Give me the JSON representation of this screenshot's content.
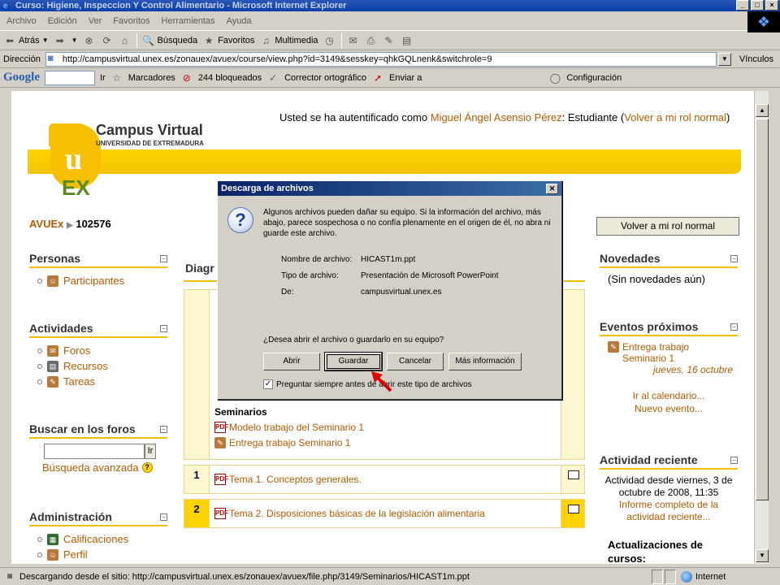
{
  "window": {
    "title": "Curso: Higiene, Inspeccion Y Control Alimentario - Microsoft Internet Explorer"
  },
  "menu": [
    "Archivo",
    "Edición",
    "Ver",
    "Favoritos",
    "Herramientas",
    "Ayuda"
  ],
  "toolbar": {
    "back": "Atrás",
    "search": "Búsqueda",
    "favorites": "Favoritos",
    "multimedia": "Multimedia"
  },
  "address": {
    "label": "Dirección",
    "url": "http://campusvirtual.unex.es/zonauex/avuex/course/view.php?id=3149&sesskey=qhkGQLnenk&switchrole=9",
    "links": "Vínculos"
  },
  "google_bar": {
    "logo": "Google",
    "go": "Ir",
    "bookmarks": "Marcadores",
    "blocked": "244 bloqueados",
    "spell": "Corrector ortográfico",
    "send": "Enviar a",
    "settings": "Configuración"
  },
  "page": {
    "logged_prefix": "Usted se ha autentificado como ",
    "user_name": "Miguel Ángel Asensio Pérez",
    "logged_role": ": Estudiante (",
    "back_role_link": "Volver a mi rol normal",
    "logged_suffix": ")",
    "logo_title": "Campus Virtual",
    "logo_sub": "UNIVERSIDAD DE EXTREMADURA",
    "logo_u": "u",
    "logo_ex": "EX",
    "crumb_root": "AVUEx",
    "crumb_course": "102576",
    "back_role_button": "Volver a mi rol normal",
    "center_title": "Diagr",
    "seminarios": "Seminarios",
    "seminar_links": [
      "Modelo trabajo del Seminario 1",
      "Entrega trabajo Seminario 1"
    ],
    "topics": [
      {
        "num": "1",
        "link": "Tema 1. Conceptos generales."
      },
      {
        "num": "2",
        "link": "Tema 2. Disposiciones básicas de la legislación alimentaria"
      }
    ]
  },
  "left_blocks": {
    "personas": {
      "title": "Personas",
      "items": [
        "Participantes"
      ]
    },
    "actividades": {
      "title": "Actividades",
      "items": [
        "Foros",
        "Recursos",
        "Tareas"
      ]
    },
    "buscar": {
      "title": "Buscar en los foros",
      "go": "Ir",
      "advanced": "Búsqueda avanzada"
    },
    "admin": {
      "title": "Administración",
      "items": [
        "Calificaciones",
        "Perfil"
      ]
    }
  },
  "right_blocks": {
    "novedades": {
      "title": "Novedades",
      "text": "(Sin novedades aún)"
    },
    "eventos": {
      "title": "Eventos próximos",
      "event_link": "Entrega trabajo Seminario 1",
      "event_date": "jueves, 16 octubre",
      "calendar": "Ir al calendario...",
      "new_event": "Nuevo evento..."
    },
    "actividad": {
      "title": "Actividad reciente",
      "since": "Actividad desde viernes, 3 de octubre de 2008, 11:35",
      "report": "Informe completo de la actividad reciente...",
      "updates": "Actualizaciones de cursos:"
    }
  },
  "dialog": {
    "title": "Descarga de archivos",
    "warning": "Algunos archivos pueden dañar su equipo. Si la información del archivo, más abajo, parece sospechosa o no confía plenamente en el origen de él, no abra ni guarde este archivo.",
    "fields": [
      {
        "key": "Nombre de archivo:",
        "value": "HICAST1m.ppt"
      },
      {
        "key": "Tipo de archivo:",
        "value": "Presentación de Microsoft PowerPoint"
      },
      {
        "key": "De:",
        "value": "campusvirtual.unex.es"
      }
    ],
    "question": "¿Desea abrir el archivo o guardarlo en su equipo?",
    "buttons": {
      "open": "Abrir",
      "save": "Guardar",
      "cancel": "Cancelar",
      "more": "Más información"
    },
    "checkbox": "Preguntar siempre antes de abrir este tipo de archivos"
  },
  "status": {
    "text": "Descargando desde el sitio: http://campusvirtual.unex.es/zonauex/avuex/file.php/3149/Seminarios/HICAST1m.ppt",
    "zone": "Internet"
  },
  "colors": {
    "link": "#b45b00",
    "accent_yellow": "#f6c000",
    "title_bar": "#0a246a"
  }
}
